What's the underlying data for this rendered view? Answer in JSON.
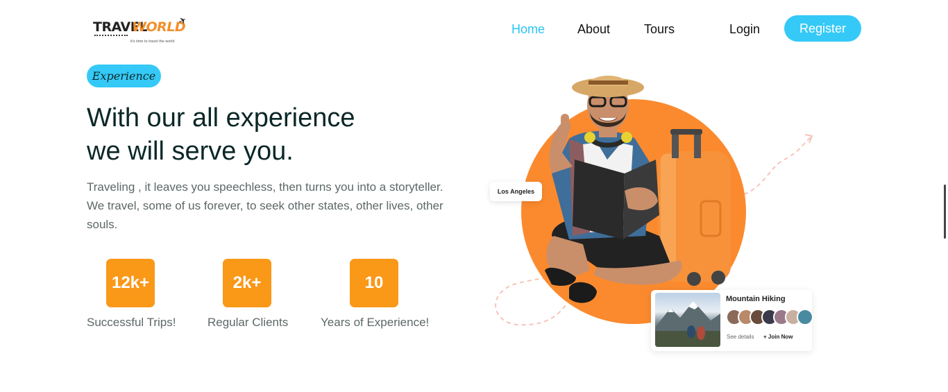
{
  "logo": {
    "word1": "TRAVEL",
    "word2": "WORLD",
    "tagline": "it's time to travel the world"
  },
  "nav": {
    "home": "Home",
    "about": "About",
    "tours": "Tours"
  },
  "auth": {
    "login": "Login",
    "register": "Register"
  },
  "hero": {
    "badge": "Experience",
    "headline_line1": "With our all experience",
    "headline_line2": "we will serve you.",
    "desc_line1": "Traveling , it leaves you speechless, then turns you into a storyteller.",
    "desc_line2": "We travel, some of us forever, to seek other states, other lives, other",
    "desc_line3": "souls."
  },
  "stats": [
    {
      "value": "12k+",
      "label": "Successful Trips!"
    },
    {
      "value": "2k+",
      "label": "Regular Clients"
    },
    {
      "value": "10",
      "label": "Years of Experience!"
    }
  ],
  "location_card": {
    "label": "Los Angeles"
  },
  "hiking_card": {
    "title": "Mountain Hiking",
    "see_details": "See details",
    "join": "+ Join Now"
  },
  "colors": {
    "accent": "#35c9f7",
    "stat_orange": "#fa9818",
    "circle_orange": "#fb8a2e",
    "heading": "#0b2727",
    "text": "#5d6767"
  },
  "icons": {
    "plane": "plane-icon"
  }
}
